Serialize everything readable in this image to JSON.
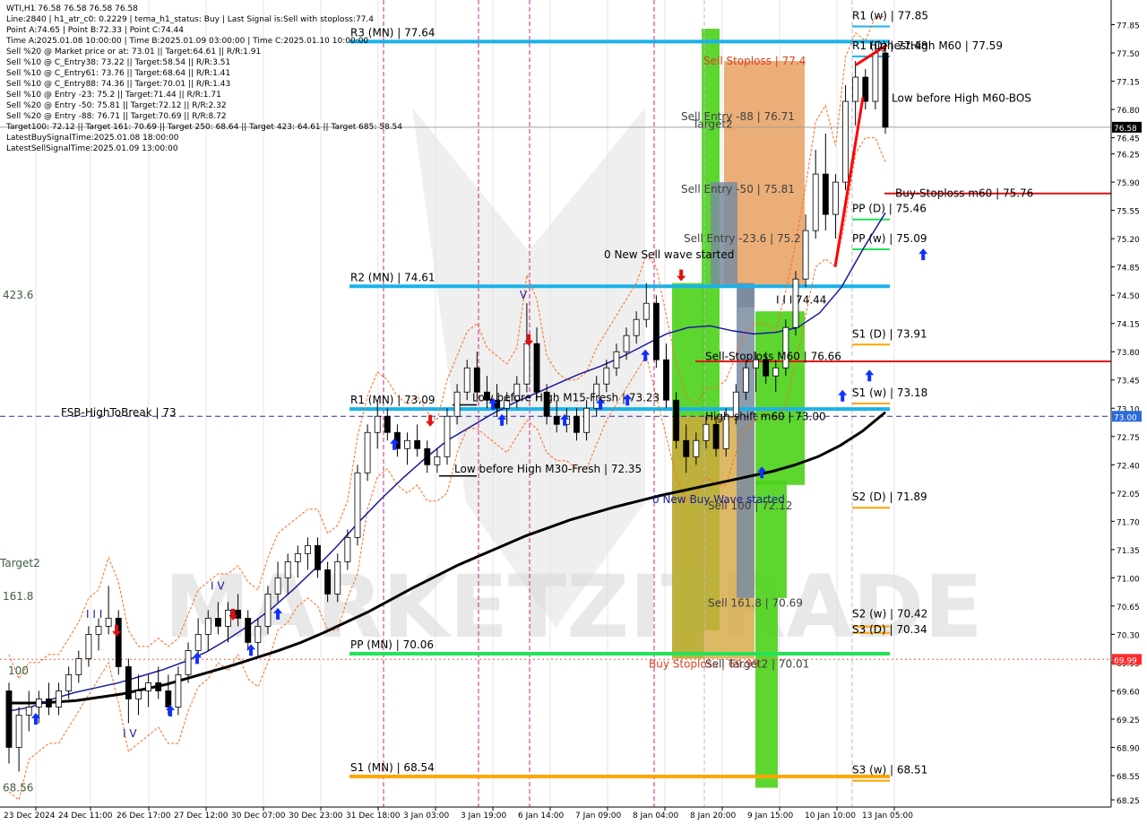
{
  "info": {
    "lines": [
      "WTI,H1  76.58 76.58 76.58 76.58",
      "Line:2840  | h1_atr_c0: 0.2229  | tema_h1_status: Buy  | Last Signal is:Sell with stoploss:77.4",
      "Point A:74.65  | Point B:72.33  | Point C:74.44",
      "Time A:2025.01.08 10:00:00  | Time B:2025.01.09 03:00:00  | Time C:2025.01.10 10:00:00",
      "Sell %20 @ Market price or at: 73.01  || Target:64.61  || R/R:1.91",
      "Sell %10 @ C_Entry38: 73.22  || Target:58.54  || R/R:3.51",
      "Sell %10 @ C_Entry61: 73.76  || Target:68.64  || R/R:1.41",
      "Sell %10 @ C_Entry88: 74.36  || Target:70.01  || R/R:1.43",
      "Sell %10 @ Entry -23: 75.2  || Target:71.44  || R/R:1.71",
      "Sell %20 @ Entry -50: 75.81  || Target:72.12  || R/R:2.32",
      "Sell %20 @ Entry -88: 76.71  || Target:70.69  || R/R:8.72",
      "Target100: 72.12  || Target 161: 70.69  || Target 250: 68.64  || Target 423: 64.61  || Target 685: 58.54",
      "LatestBuySignalTime:2025.01.08 18:00:00",
      "LatestSellSignalTime:2025.01.09 13:00:00"
    ]
  },
  "colors": {
    "pivot_line": "#1ab2e8",
    "pp_green": "#22e35a",
    "s_orange": "#ffa500",
    "sell_red": "#e01010",
    "buy_blue": "#1030ff",
    "ma_dark": "#000000",
    "ma_blue": "#1a1a9c",
    "price_red": "#ff0000",
    "green_zone": "#4cd11a",
    "orange_zone": "#e8a060",
    "gray_zone": "#7a8ca0",
    "tan_zone": "#d4a840"
  },
  "chart_data": {
    "type": "candlestick",
    "symbol": "WTI,H1",
    "ylim": [
      68.25,
      78.0
    ],
    "y_ticks": [
      "77.85",
      "77.50",
      "77.15",
      "76.80",
      "76.45",
      "76.25",
      "75.90",
      "75.55",
      "75.20",
      "74.85",
      "74.50",
      "74.15",
      "73.80",
      "73.45",
      "73.10",
      "72.75",
      "72.40",
      "72.05",
      "71.70",
      "71.35",
      "71.00",
      "70.65",
      "70.30",
      "69.95",
      "69.60",
      "69.25",
      "68.90",
      "68.55",
      "68.25"
    ],
    "x_labels": [
      "23 Dec 2024",
      "24 Dec 11:00",
      "26 Dec 17:00",
      "27 Dec 12:00",
      "30 Dec 07:00",
      "30 Dec 23:00",
      "31 Dec 18:00",
      "3 Jan 03:00",
      "3 Jan 19:00",
      "6 Jan 14:00",
      "7 Jan 09:00",
      "8 Jan 04:00",
      "8 Jan 20:00",
      "9 Jan 15:00",
      "10 Jan 10:00",
      "13 Jan 05:00"
    ],
    "current_price": "76.58",
    "current_price_value": 76.58,
    "level_73": "73.00",
    "level_69_99": "69.99",
    "pivot_levels": [
      {
        "label": "R3 (MN) | 77.64",
        "value": 77.64,
        "color": "#1ab2e8"
      },
      {
        "label": "R2 (MN) | 74.61",
        "value": 74.61,
        "color": "#1ab2e8"
      },
      {
        "label": "R1 (MN) | 73.09",
        "value": 73.09,
        "color": "#1ab2e8"
      },
      {
        "label": "PP (MN) | 70.06",
        "value": 70.06,
        "color": "#22e35a"
      },
      {
        "label": "S1 (MN) | 68.54",
        "value": 68.54,
        "color": "#ffa500"
      }
    ],
    "right_levels": [
      {
        "label": "R1 (w) | 77.85",
        "value": 77.85,
        "color": "#1ab2e8"
      },
      {
        "label": "R1 (D) | 77.48",
        "value": 77.48,
        "color": "#1ab2e8"
      },
      {
        "label": "PP (D) | 75.46",
        "value": 75.46,
        "color": "#22e35a"
      },
      {
        "label": "PP (w) | 75.09",
        "value": 75.09,
        "color": "#22e35a"
      },
      {
        "label": "S1 (D) | 73.91",
        "value": 73.91,
        "color": "#ffa500"
      },
      {
        "label": "S1 (w) | 73.18",
        "value": 73.18,
        "color": "#ffa500"
      },
      {
        "label": "S2 (D) | 71.89",
        "value": 71.89,
        "color": "#ffa500"
      },
      {
        "label": "S2 (w) | 70.42",
        "value": 70.42,
        "color": "#ffa500"
      },
      {
        "label": "S3 (D) | 70.34",
        "value": 70.34,
        "color": "#ffa500"
      },
      {
        "label": "S3 (w) | 68.51",
        "value": 68.51,
        "color": "#ffa500"
      }
    ],
    "annotations": [
      {
        "text": "HighestHigh   M60 | 77.59",
        "value": 77.59
      },
      {
        "text": "Low before High   M60-BOS",
        "value": 76.94
      },
      {
        "text": "Buy-Stoploss m60 | 75.76",
        "value": 75.76
      },
      {
        "text": "Sell Stoploss | 77.4",
        "value": 77.4
      },
      {
        "text": "Sell Entry -88 | 76.71",
        "value": 76.71
      },
      {
        "text": "Target2",
        "value": 76.62
      },
      {
        "text": "Sell Entry -50 | 75.81",
        "value": 75.81
      },
      {
        "text": "Sell Entry -23.6 | 75.2",
        "value": 75.2
      },
      {
        "text": "I I I 74.44",
        "value": 74.44
      },
      {
        "text": "0 New Sell wave started",
        "value": 75.0
      },
      {
        "text": "Sell-Stoploss M60 | 76.66",
        "value": 73.74
      },
      {
        "text": "High-shift m60 | 73.00",
        "value": 73.0
      },
      {
        "text": "Low before High   M15-Fresh | 73.23",
        "value": 73.23
      },
      {
        "text": "Low before High   M30-Fresh | 72.35",
        "value": 72.35
      },
      {
        "text": "0 New Buy Wave started",
        "value": 71.97
      },
      {
        "text": "Sell 100 | 72.12",
        "value": 71.89
      },
      {
        "text": "Sell 161.8 | 70.69",
        "value": 70.69
      },
      {
        "text": "Buy Stoploss | 69.99",
        "value": 69.93
      },
      {
        "text": "Sell Target2 | 70.01",
        "value": 69.93
      },
      {
        "text": "FSB-HighToBreak | 73",
        "value": 73.05
      },
      {
        "text": "423.6",
        "value": 74.5
      },
      {
        "text": "Target2",
        "value": 71.18
      },
      {
        "text": "161.8",
        "value": 70.77
      },
      {
        "text": "100",
        "value": 69.85
      },
      {
        "text": "68.56",
        "value": 68.4
      },
      {
        "text": "I V",
        "value": 70.9
      },
      {
        "text": "I I I",
        "value": 70.55
      },
      {
        "text": "I V",
        "value": 69.07
      },
      {
        "text": "V",
        "value": 74.5
      }
    ],
    "series": [
      {
        "name": "H1",
        "ohlc": [
          [
            69.6,
            69.7,
            68.7,
            68.9
          ],
          [
            68.9,
            69.4,
            68.6,
            69.3
          ],
          [
            69.3,
            69.6,
            69.1,
            69.4
          ],
          [
            69.4,
            69.6,
            69.2,
            69.5
          ],
          [
            69.5,
            69.7,
            69.3,
            69.4
          ],
          [
            69.4,
            69.7,
            69.3,
            69.6
          ],
          [
            69.6,
            69.9,
            69.5,
            69.8
          ],
          [
            69.8,
            70.1,
            69.7,
            70.0
          ],
          [
            70.0,
            70.4,
            69.9,
            70.3
          ],
          [
            70.3,
            70.5,
            70.1,
            70.4
          ],
          [
            70.4,
            70.9,
            70.3,
            70.5
          ],
          [
            70.5,
            70.6,
            69.8,
            69.9
          ],
          [
            69.9,
            70.0,
            69.2,
            69.5
          ],
          [
            69.5,
            69.8,
            69.3,
            69.6
          ],
          [
            69.6,
            69.8,
            69.4,
            69.7
          ],
          [
            69.7,
            69.9,
            69.5,
            69.6
          ],
          [
            69.6,
            69.8,
            69.3,
            69.4
          ],
          [
            69.4,
            69.9,
            69.3,
            69.8
          ],
          [
            69.8,
            70.2,
            69.7,
            70.1
          ],
          [
            70.1,
            70.5,
            70.0,
            70.3
          ],
          [
            70.3,
            70.6,
            70.1,
            70.5
          ],
          [
            70.5,
            70.7,
            70.3,
            70.4
          ],
          [
            70.4,
            70.7,
            70.2,
            70.6
          ],
          [
            70.6,
            70.8,
            70.4,
            70.5
          ],
          [
            70.5,
            70.6,
            70.1,
            70.2
          ],
          [
            70.2,
            70.5,
            70.0,
            70.4
          ],
          [
            70.4,
            70.9,
            70.3,
            70.8
          ],
          [
            70.8,
            71.2,
            70.7,
            71.0
          ],
          [
            71.0,
            71.3,
            70.8,
            71.2
          ],
          [
            71.2,
            71.4,
            71.0,
            71.3
          ],
          [
            71.3,
            71.5,
            71.1,
            71.4
          ],
          [
            71.4,
            71.5,
            71.0,
            71.1
          ],
          [
            71.1,
            71.2,
            70.7,
            70.8
          ],
          [
            70.8,
            71.3,
            70.7,
            71.2
          ],
          [
            71.2,
            71.6,
            71.1,
            71.5
          ],
          [
            71.5,
            72.4,
            71.4,
            72.3
          ],
          [
            72.3,
            72.9,
            72.2,
            72.8
          ],
          [
            72.8,
            73.2,
            72.6,
            73.0
          ],
          [
            73.0,
            73.1,
            72.7,
            72.8
          ],
          [
            72.8,
            72.9,
            72.5,
            72.6
          ],
          [
            72.6,
            72.8,
            72.4,
            72.7
          ],
          [
            72.7,
            72.9,
            72.5,
            72.6
          ],
          [
            72.6,
            72.7,
            72.3,
            72.4
          ],
          [
            72.4,
            72.6,
            72.3,
            72.5
          ],
          [
            72.5,
            73.1,
            72.4,
            73.0
          ],
          [
            73.0,
            73.4,
            72.9,
            73.3
          ],
          [
            73.3,
            73.7,
            73.2,
            73.6
          ],
          [
            73.6,
            73.8,
            73.2,
            73.3
          ],
          [
            73.3,
            73.5,
            73.1,
            73.2
          ],
          [
            73.2,
            73.4,
            73.0,
            73.1
          ],
          [
            73.1,
            73.3,
            72.9,
            73.2
          ],
          [
            73.2,
            73.5,
            73.1,
            73.4
          ],
          [
            73.4,
            74.4,
            73.3,
            73.9
          ],
          [
            73.9,
            74.1,
            73.2,
            73.3
          ],
          [
            73.3,
            73.4,
            72.9,
            73.0
          ],
          [
            73.0,
            73.2,
            72.8,
            72.9
          ],
          [
            72.9,
            73.1,
            72.8,
            73.0
          ],
          [
            73.0,
            73.1,
            72.7,
            72.8
          ],
          [
            72.8,
            73.2,
            72.7,
            73.1
          ],
          [
            73.1,
            73.5,
            73.0,
            73.4
          ],
          [
            73.4,
            73.7,
            73.3,
            73.6
          ],
          [
            73.6,
            73.9,
            73.5,
            73.8
          ],
          [
            73.8,
            74.1,
            73.7,
            74.0
          ],
          [
            74.0,
            74.3,
            73.9,
            74.2
          ],
          [
            74.2,
            74.65,
            74.1,
            74.4
          ],
          [
            74.4,
            74.5,
            73.6,
            73.7
          ],
          [
            73.7,
            73.9,
            73.1,
            73.2
          ],
          [
            73.2,
            73.3,
            72.6,
            72.7
          ],
          [
            72.7,
            72.9,
            72.3,
            72.5
          ],
          [
            72.5,
            72.8,
            72.4,
            72.7
          ],
          [
            72.7,
            73.0,
            72.6,
            72.9
          ],
          [
            72.9,
            73.0,
            72.5,
            72.6
          ],
          [
            72.6,
            73.1,
            72.5,
            73.0
          ],
          [
            73.0,
            73.4,
            72.9,
            73.3
          ],
          [
            73.3,
            73.7,
            73.2,
            73.6
          ],
          [
            73.6,
            73.8,
            73.3,
            73.7
          ],
          [
            73.7,
            73.8,
            73.4,
            73.5
          ],
          [
            73.5,
            73.7,
            73.3,
            73.6
          ],
          [
            73.6,
            74.2,
            73.5,
            74.1
          ],
          [
            74.1,
            74.8,
            74.0,
            74.7
          ],
          [
            74.7,
            75.5,
            74.6,
            75.3
          ],
          [
            75.3,
            76.3,
            75.2,
            76.0
          ],
          [
            76.0,
            76.5,
            75.3,
            75.5
          ],
          [
            75.5,
            76.0,
            75.2,
            75.9
          ],
          [
            75.9,
            77.1,
            75.8,
            76.9
          ],
          [
            76.9,
            77.4,
            76.6,
            77.2
          ],
          [
            77.2,
            77.3,
            76.8,
            76.9
          ],
          [
            76.9,
            77.6,
            76.8,
            77.5
          ],
          [
            77.5,
            77.6,
            76.5,
            76.58
          ]
        ]
      },
      {
        "name": "MA slow",
        "values": [
          69.45,
          69.45,
          69.46,
          69.48,
          69.52,
          69.56,
          69.62,
          69.68,
          69.76,
          69.84,
          69.92,
          70.01,
          70.1,
          70.2,
          70.32,
          70.45,
          70.58,
          70.73,
          70.88,
          71.02,
          71.16,
          71.28,
          71.4,
          71.52,
          71.62,
          71.72,
          71.8,
          71.88,
          71.95,
          72.02,
          72.08,
          72.14,
          72.2,
          72.26,
          72.32,
          72.4,
          72.5,
          72.64,
          72.82,
          73.05
        ]
      },
      {
        "name": "MA fast",
        "values": [
          69.35,
          69.4,
          69.5,
          69.58,
          69.64,
          69.7,
          69.78,
          69.86,
          69.96,
          70.08,
          70.24,
          70.42,
          70.62,
          70.86,
          71.12,
          71.4,
          71.7,
          71.98,
          72.24,
          72.48,
          72.7,
          72.86,
          73.02,
          73.16,
          73.28,
          73.4,
          73.52,
          73.62,
          73.74,
          73.88,
          74.02,
          74.1,
          74.12,
          74.06,
          74.02,
          74.04,
          74.1,
          74.28,
          74.6,
          75.08,
          75.52
        ]
      }
    ],
    "arrows": [
      {
        "direction": "up",
        "x_index": 3,
        "value": 69.25
      },
      {
        "direction": "down",
        "x_index": 12,
        "value": 70.35
      },
      {
        "direction": "up",
        "x_index": 18,
        "value": 69.35
      },
      {
        "direction": "up",
        "x_index": 21,
        "value": 70.0
      },
      {
        "direction": "up",
        "x_index": 27,
        "value": 70.1
      },
      {
        "direction": "down",
        "x_index": 25,
        "value": 70.55
      },
      {
        "direction": "up",
        "x_index": 30,
        "value": 70.55
      },
      {
        "direction": "up",
        "x_index": 43,
        "value": 72.65
      },
      {
        "direction": "down",
        "x_index": 47,
        "value": 72.95
      },
      {
        "direction": "up",
        "x_index": 54,
        "value": 73.15
      },
      {
        "direction": "up",
        "x_index": 55,
        "value": 72.95
      },
      {
        "direction": "up",
        "x_index": 62,
        "value": 72.95
      },
      {
        "direction": "up",
        "x_index": 66,
        "value": 73.15
      },
      {
        "direction": "down",
        "x_index": 58,
        "value": 73.95
      },
      {
        "direction": "up",
        "x_index": 69,
        "value": 73.2
      },
      {
        "direction": "up",
        "x_index": 71,
        "value": 73.75
      },
      {
        "direction": "down",
        "x_index": 75,
        "value": 74.75
      },
      {
        "direction": "up",
        "x_index": 84,
        "value": 72.3
      },
      {
        "direction": "up",
        "x_index": 93,
        "value": 73.25
      },
      {
        "direction": "up",
        "x_index": 96,
        "value": 73.5
      },
      {
        "direction": "up",
        "x_index": 102,
        "value": 75.0
      }
    ]
  }
}
